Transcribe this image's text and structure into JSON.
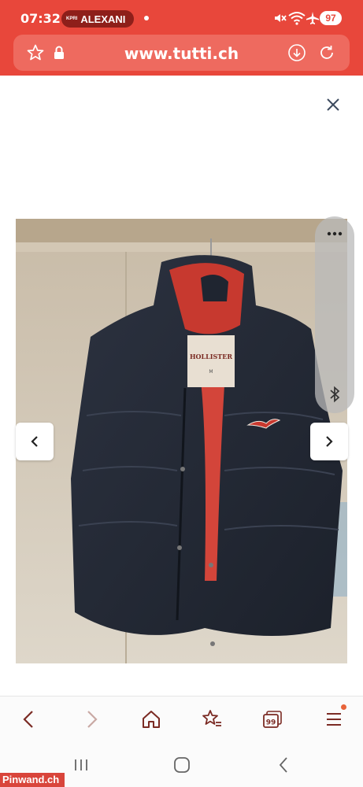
{
  "status_bar": {
    "time": "07:32",
    "notification_tag": "KPRI",
    "notification_name": "ALEXANI",
    "battery": "97"
  },
  "address_bar": {
    "url": "www.tutti.ch"
  },
  "viewer": {
    "photo_label": "HOLLISTER",
    "photo_size": "M"
  },
  "watermark": {
    "text": "Pinwand.ch"
  },
  "colors": {
    "brand_red": "#e8473b",
    "address_bar": "#ee6a5f",
    "icon_dark": "#7b2b24"
  }
}
